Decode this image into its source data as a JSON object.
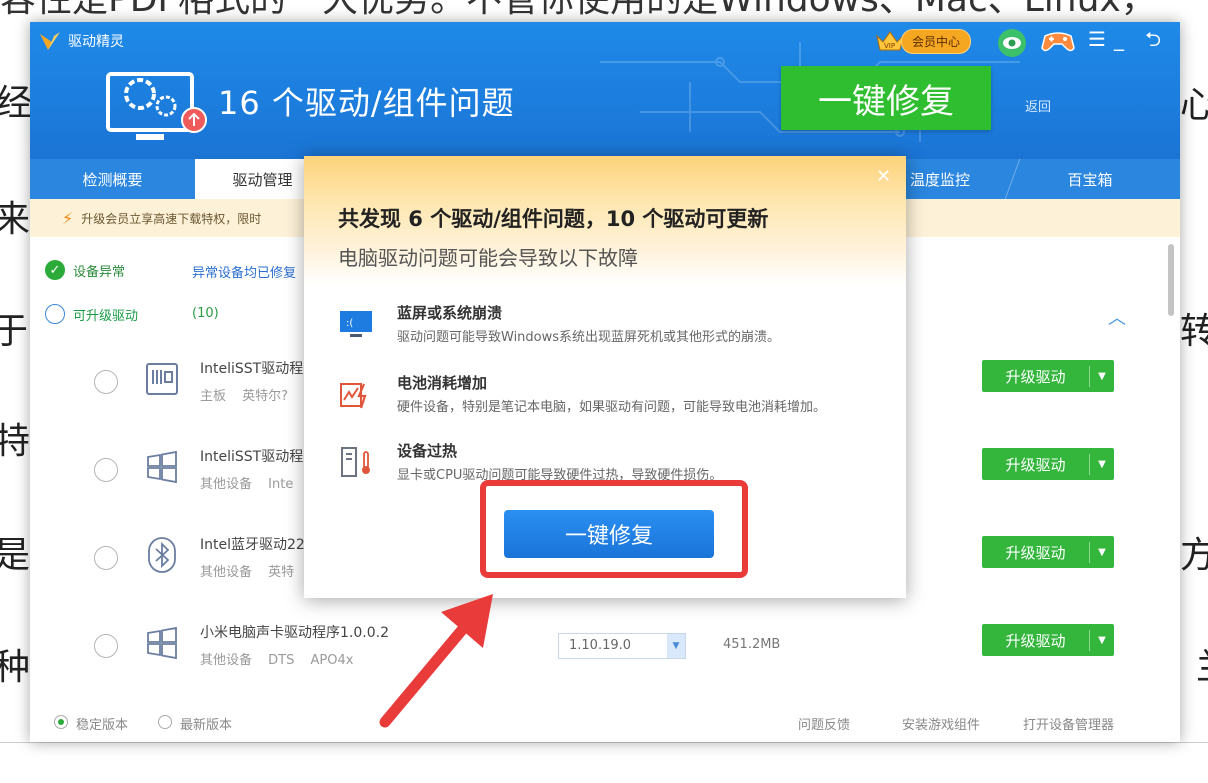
{
  "background": {
    "top_line": "容性是PDF格式的一大优势。不管你使用的是Windows、Mac、Linux，",
    "left_chars": [
      "经",
      "来",
      "于",
      "特",
      "是",
      "种"
    ],
    "right_chars": [
      "心",
      "转",
      "方",
      "兰"
    ]
  },
  "window": {
    "app_name": "驱动精灵",
    "vip_label": "会员中心",
    "header_title": "16 个驱动/组件问题",
    "fix_button": "一键修复",
    "back_link": "返回",
    "controls": {
      "menu": "☰",
      "minimize": "_",
      "restore": "⮌"
    }
  },
  "tabs": [
    {
      "label": "检测概要"
    },
    {
      "label": "驱动管理",
      "active": true
    },
    {
      "label": "温度监控"
    },
    {
      "label": "百宝箱"
    }
  ],
  "notice": "升级会员立享高速下载特权，限时",
  "sections": {
    "abnormal": {
      "label": "设备异常",
      "note": "异常设备均已修复"
    },
    "upgradable": {
      "label": "可升级驱动",
      "count": "(10)"
    }
  },
  "devices": [
    {
      "name": "InteliSST驱动程",
      "category": "主板",
      "vendor": "英特尔?",
      "action": "升级驱动",
      "icon": "chip-icon"
    },
    {
      "name": "InteliSST驱动程",
      "category": "其他设备",
      "vendor": "Inte",
      "action": "升级驱动",
      "icon": "windows-icon"
    },
    {
      "name": "Intel蓝牙驱动22",
      "category": "其他设备",
      "vendor": "英特",
      "action": "升级驱动",
      "icon": "bluetooth-icon"
    },
    {
      "name": "小米电脑声卡驱动程序1.0.0.2",
      "category": "其他设备",
      "vendor": "DTS APO4x",
      "action": "升级驱动",
      "icon": "windows-icon",
      "version": "1.10.19.0",
      "size": "451.2MB"
    }
  ],
  "footer": {
    "stable": "稳定版本",
    "latest": "最新版本",
    "feedback": "问题反馈",
    "install_game": "安装游戏组件",
    "open_device_mgr": "打开设备管理器"
  },
  "popup": {
    "close": "✕",
    "title": "共发现 6 个驱动/组件问题，10 个驱动可更新",
    "subtitle": "电脑驱动问题可能会导致以下故障",
    "issues": [
      {
        "title": "蓝屏或系统崩溃",
        "desc": "驱动问题可能导致Windows系统出现蓝屏死机或其他形式的崩溃。",
        "icon": "bluescreen-icon"
      },
      {
        "title": "电池消耗增加",
        "desc": "硬件设备，特别是笔记本电脑，如果驱动有问题，可能导致电池消耗增加。",
        "icon": "battery-icon"
      },
      {
        "title": "设备过热",
        "desc": "显卡或CPU驱动问题可能导致硬件过热，导致硬件损伤。",
        "icon": "thermometer-icon"
      }
    ],
    "fix_button": "一键修复"
  },
  "colors": {
    "header_blue": "#1f8ae8",
    "fix_green": "#2fbe2f",
    "upgrade_green": "#34b53c",
    "popup_blue": "#1a74d8",
    "annotation_red": "#ea3b3b"
  }
}
